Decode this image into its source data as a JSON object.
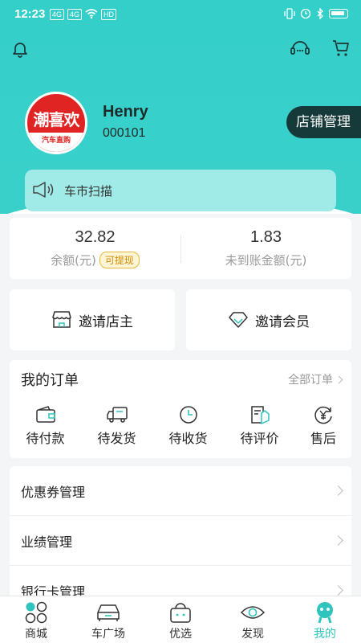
{
  "status_bar": {
    "time": "12:23",
    "network_labels": [
      "4G",
      "4G"
    ],
    "hd_label": "HD"
  },
  "header": {
    "bell_icon": "bell-icon",
    "support_icon": "headset-chat-icon",
    "cart_icon": "cart-icon",
    "avatar_logo_text": "潮喜欢",
    "avatar_sub_text": "汽车直购",
    "username": "Henry",
    "user_id": "000101",
    "shop_manage_label": "店铺管理",
    "notice_icon": "megaphone-icon",
    "notice_text": "车市扫描"
  },
  "balance": {
    "balance_value": "32.82",
    "balance_label": "余额(元)",
    "withdraw_label": "可提现",
    "pending_value": "1.83",
    "pending_label": "未到账金额(元)"
  },
  "invite": {
    "shop_owner_label": "邀请店主",
    "member_label": "邀请会员"
  },
  "orders": {
    "title": "我的订单",
    "all_orders_label": "全部订单",
    "items": [
      {
        "label": "待付款",
        "icon": "wallet-icon"
      },
      {
        "label": "待发货",
        "icon": "truck-icon"
      },
      {
        "label": "待收货",
        "icon": "clock-icon"
      },
      {
        "label": "待评价",
        "icon": "review-icon"
      },
      {
        "label": "售后",
        "icon": "yuan-refund-icon"
      }
    ]
  },
  "menu": {
    "items": [
      {
        "label": "优惠券管理"
      },
      {
        "label": "业绩管理"
      },
      {
        "label": "银行卡管理"
      }
    ]
  },
  "tabbar": {
    "active_color": "#2fc4be",
    "items": [
      {
        "label": "商城",
        "icon": "mall-icon"
      },
      {
        "label": "车广场",
        "icon": "car-icon"
      },
      {
        "label": "优选",
        "icon": "basket-icon"
      },
      {
        "label": "发现",
        "icon": "eye-icon"
      },
      {
        "label": "我的",
        "icon": "profile-icon",
        "active": true
      }
    ]
  }
}
